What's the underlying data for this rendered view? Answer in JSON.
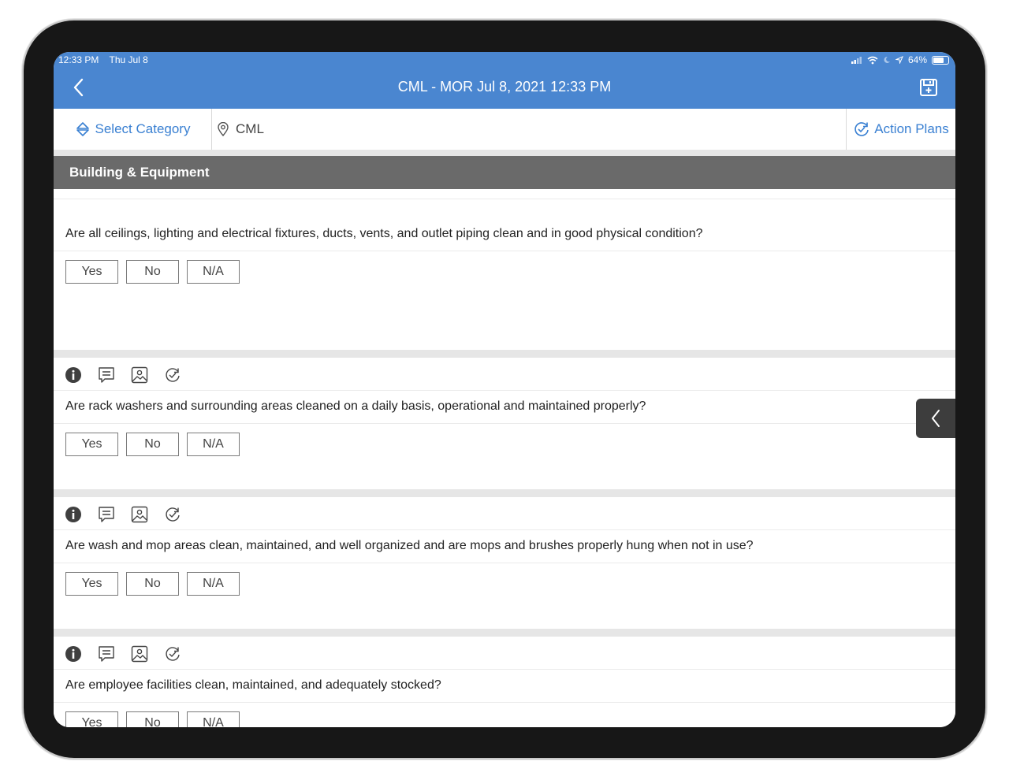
{
  "status_bar": {
    "time": "12:33 PM",
    "date": "Thu Jul 8",
    "battery": "64%"
  },
  "nav": {
    "title": "CML - MOR Jul 8, 2021 12:33 PM"
  },
  "toolbar": {
    "select_category": "Select Category",
    "location": "CML",
    "action_plans": "Action Plans"
  },
  "section": {
    "title": "Building & Equipment"
  },
  "answer_options": [
    "Yes",
    "No",
    "N/A"
  ],
  "questions": [
    {
      "text": "Are all ceilings, lighting and electrical fixtures, ducts, vents, and outlet piping clean and in good physical condition?"
    },
    {
      "text": "Are rack washers and surrounding areas cleaned on a daily basis, operational and maintained properly?"
    },
    {
      "text": "Are wash and mop areas clean, maintained, and well organized and are mops and brushes properly hung when not in use?"
    },
    {
      "text": "Are employee facilities clean, maintained, and adequately stocked?"
    }
  ],
  "colors": {
    "header_blue": "#4a86d0",
    "link_blue": "#3a80d2",
    "section_gray": "#6a6a6a"
  }
}
